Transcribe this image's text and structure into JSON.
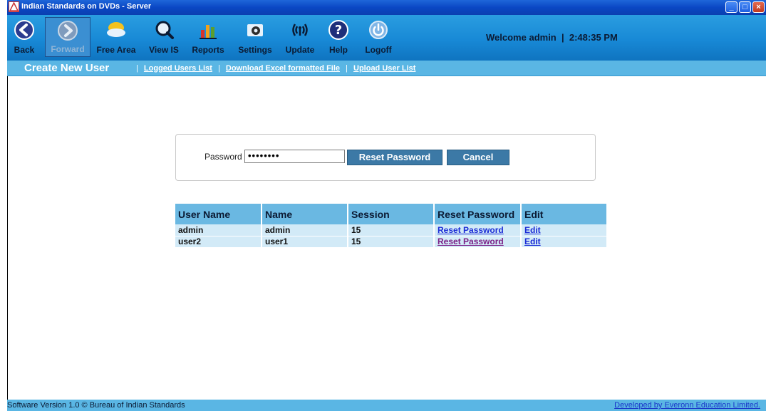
{
  "window": {
    "title": "Indian Standards on DVDs - Server",
    "buttons": [
      "_",
      "□",
      "×"
    ]
  },
  "toolbar": {
    "items": [
      {
        "label": "Back",
        "icon": "back-arrow-icon",
        "enabled": true
      },
      {
        "label": "Forward",
        "icon": "forward-arrow-icon",
        "enabled": false
      },
      {
        "label": "Free Area",
        "icon": "free-area-icon",
        "enabled": true
      },
      {
        "label": "View IS",
        "icon": "view-magnifier-icon",
        "enabled": true
      },
      {
        "label": "Reports",
        "icon": "reports-chart-icon",
        "enabled": true
      },
      {
        "label": "Settings",
        "icon": "settings-gear-icon",
        "enabled": true
      },
      {
        "label": "Update",
        "icon": "update-signal-icon",
        "enabled": true
      },
      {
        "label": "Help",
        "icon": "help-question-icon",
        "enabled": true
      },
      {
        "label": "Logoff",
        "icon": "power-icon",
        "enabled": true
      }
    ],
    "welcome_label": "Welcome",
    "user": "admin",
    "time": "2:48:35 PM"
  },
  "subnav": {
    "current": "Create New User",
    "links": [
      "Logged Users List",
      "Download Excel formatted File",
      "Upload User List"
    ]
  },
  "reset_form": {
    "password_label": "Password",
    "password_value": "••••••••",
    "reset_button": "Reset Password",
    "cancel_button": "Cancel"
  },
  "users_table": {
    "columns": [
      "User Name",
      "Name",
      "Session",
      "Reset Password",
      "Edit"
    ],
    "rows": [
      {
        "username": "admin",
        "name": "admin",
        "session": "15",
        "reset": "Reset Password",
        "edit": "Edit"
      },
      {
        "username": "user2",
        "name": "user1",
        "session": "15",
        "reset": "Reset Password",
        "edit": "Edit"
      }
    ]
  },
  "footer": {
    "left": "Software Version 1.0   © Bureau of Indian Standards",
    "right": "Developed by Everonn Education Limited."
  },
  "colors": {
    "toolbar": "#1889d6",
    "subnav": "#5ab6e4",
    "button": "#3c79a6",
    "table_header": "#6ab8e2",
    "table_row": "#d2eaf7"
  }
}
